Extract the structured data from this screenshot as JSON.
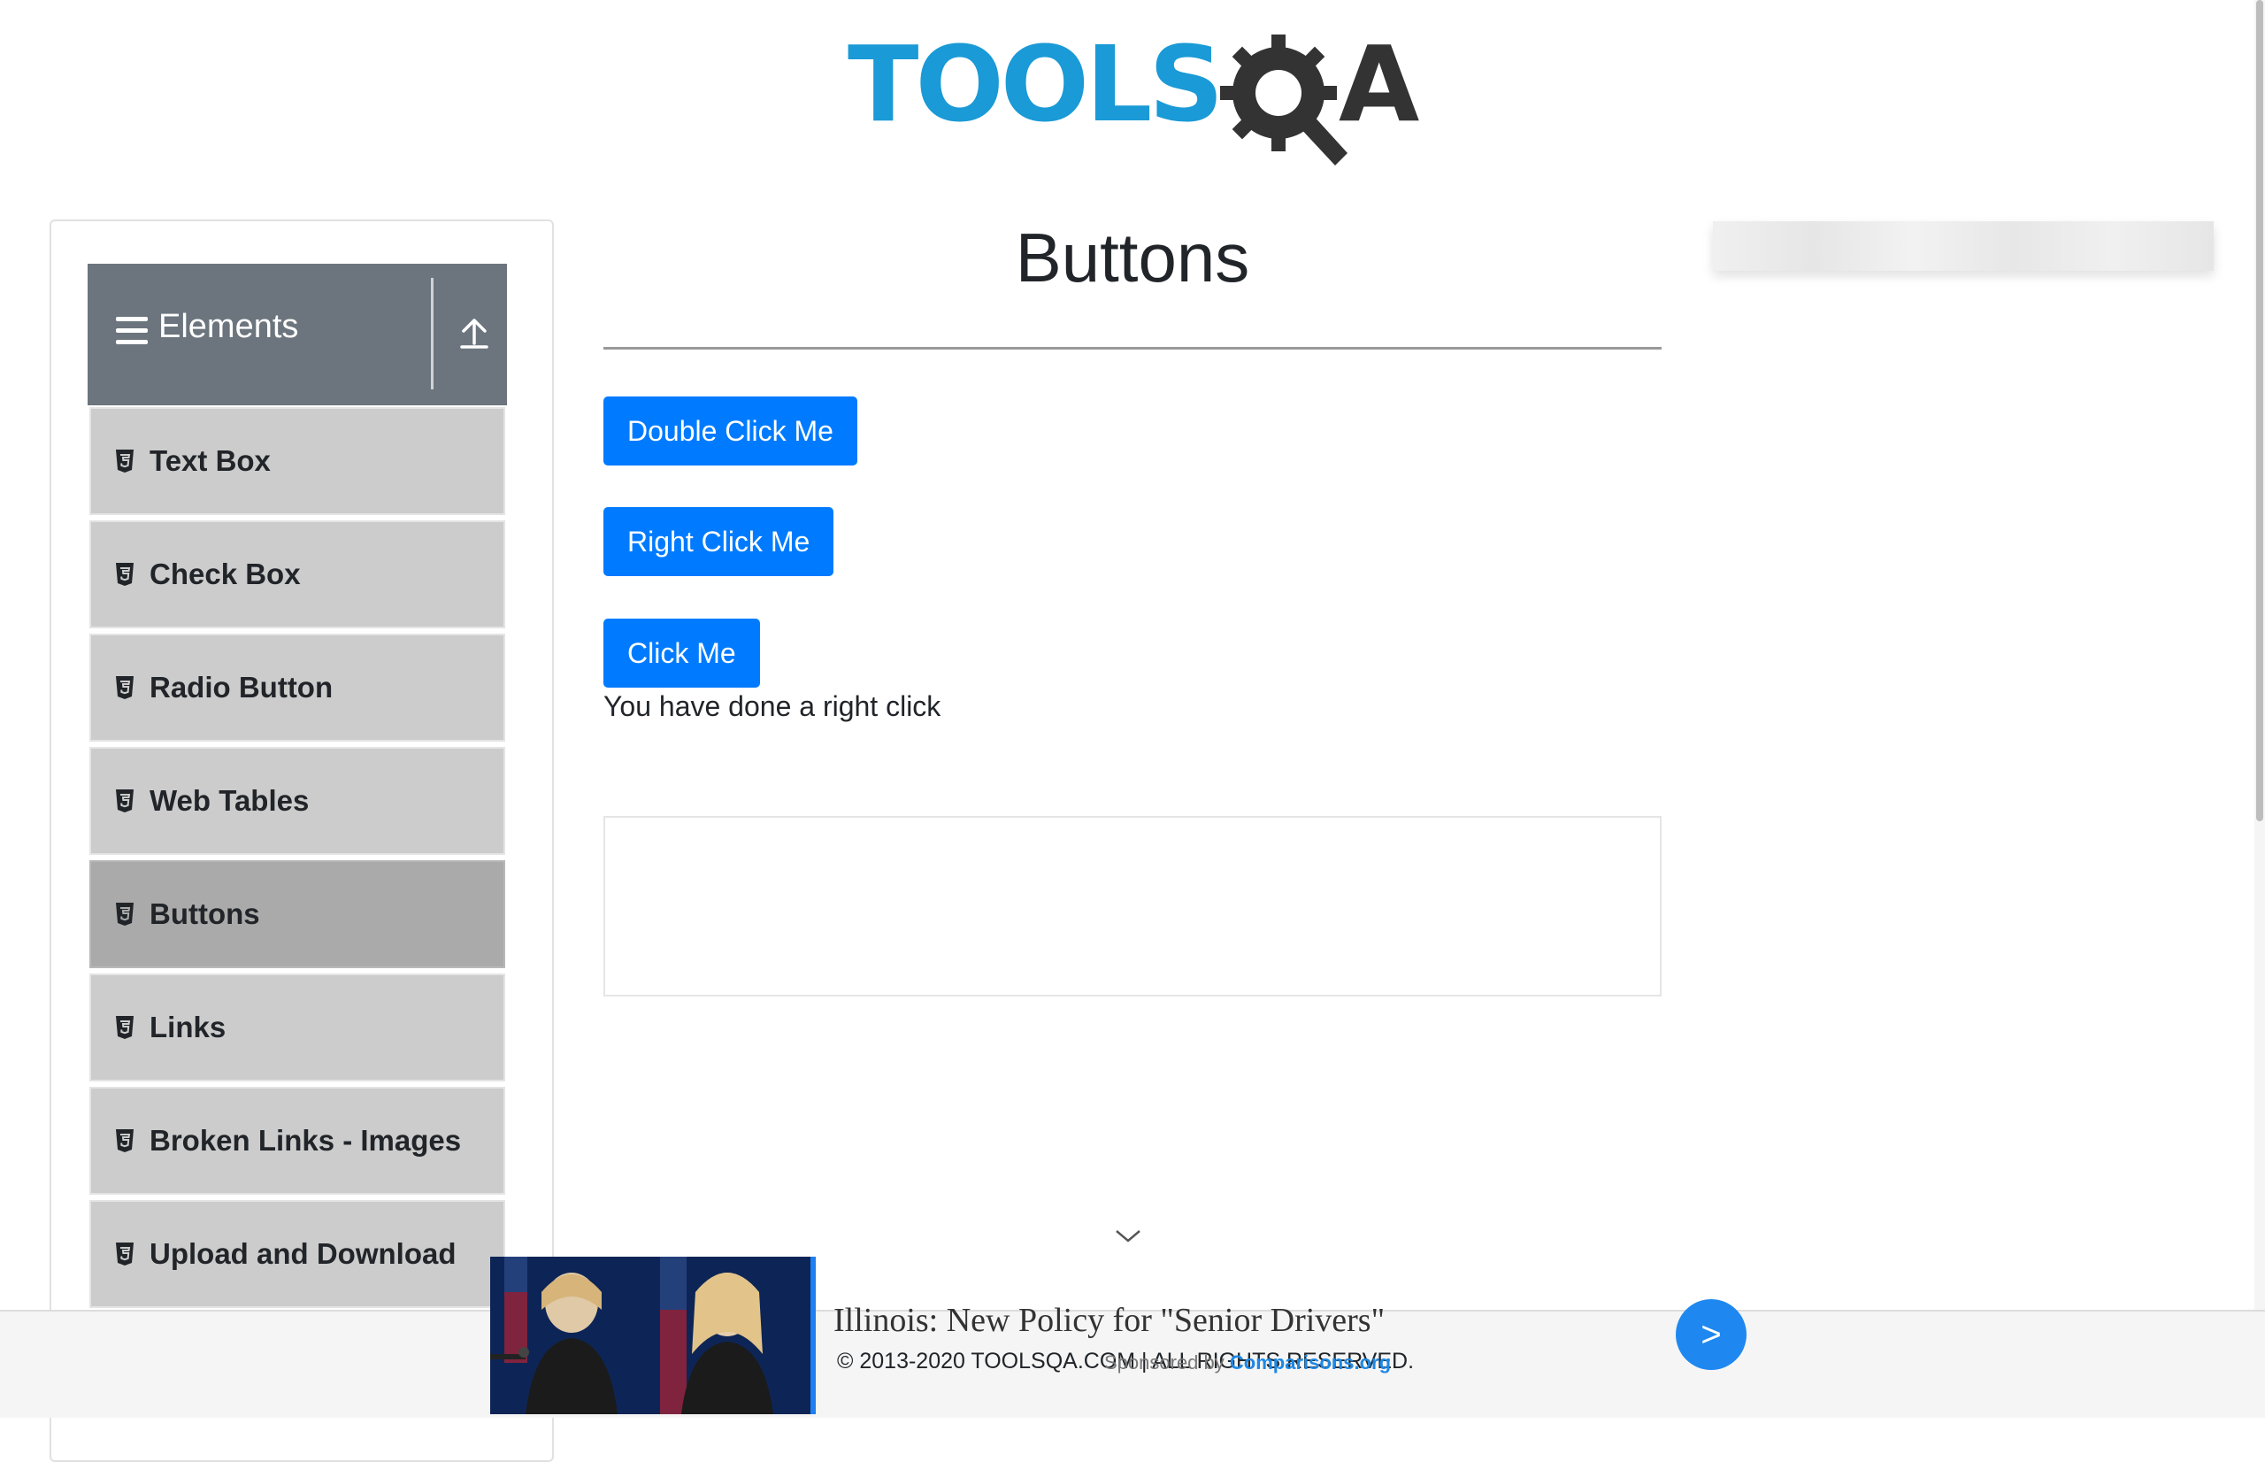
{
  "header": {
    "logo_tools": "TOOLS",
    "logo_a": "A"
  },
  "sidebar": {
    "group_title": "Elements",
    "items": [
      {
        "label": "Text Box"
      },
      {
        "label": "Check Box"
      },
      {
        "label": "Radio Button"
      },
      {
        "label": "Web Tables"
      },
      {
        "label": "Buttons",
        "active": true
      },
      {
        "label": "Links"
      },
      {
        "label": "Broken Links - Images"
      },
      {
        "label": "Upload and Download"
      }
    ]
  },
  "main": {
    "title": "Buttons",
    "double_click_label": "Double Click Me",
    "right_click_label": "Right Click Me",
    "click_label": "Click Me",
    "message": "You have done a right click"
  },
  "footer": {
    "copyright": "© 2013-2020 TOOLSQA.COM | ALL RIGHTS RESERVED."
  },
  "ad": {
    "headline": "Illinois: New Policy for \"Senior Drivers\"",
    "sponsor_prefix": "Sponsored by",
    "sponsor_brand": "Comparisons.org",
    "go_label": ">"
  },
  "colors": {
    "primary_button": "#007bff",
    "sidebar_header": "#6c757d",
    "menu_item": "#cccccc",
    "menu_item_active": "#aaaaaa"
  }
}
